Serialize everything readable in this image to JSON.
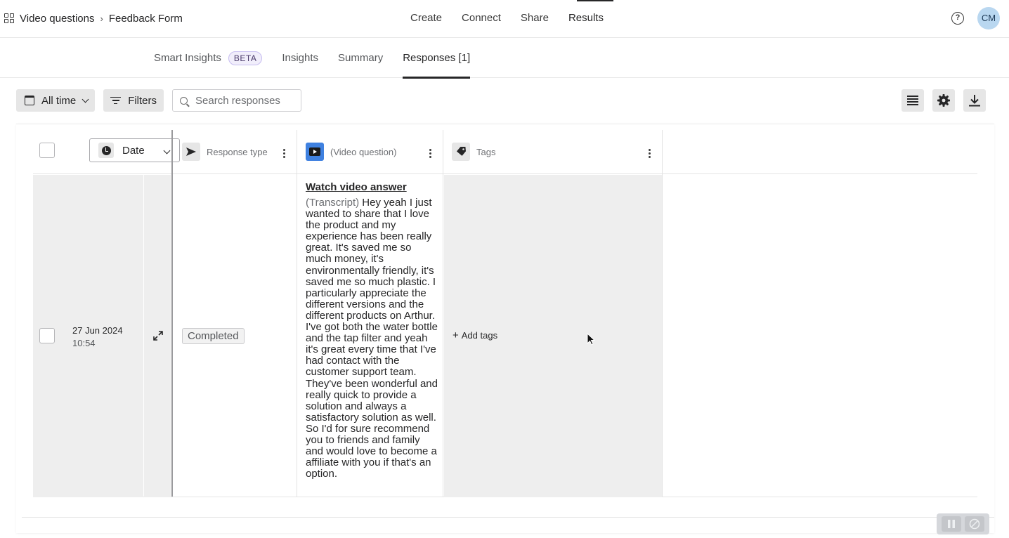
{
  "topbar": {
    "breadcrumb": [
      "Video questions",
      "Feedback Form"
    ],
    "nav": [
      "Create",
      "Connect",
      "Share",
      "Results"
    ],
    "active_nav": "Results",
    "help_glyph": "?",
    "avatar_initials": "CM",
    "avatar_color": "#b9d7f0"
  },
  "tabs": {
    "items": [
      {
        "label": "Smart Insights",
        "badge": "BETA"
      },
      {
        "label": "Insights"
      },
      {
        "label": "Summary"
      },
      {
        "label": "Responses [1]"
      }
    ],
    "active": "Responses [1]",
    "badge_color": "#c7bdf0"
  },
  "toolbar": {
    "date_range": "All time",
    "filters_label": "Filters",
    "search_placeholder": "Search responses",
    "icons": [
      "list-view-icon",
      "gear-icon",
      "download-icon"
    ]
  },
  "table": {
    "date_column_label": "Date",
    "columns": [
      {
        "label": "Response type",
        "icon": "send-arrow-icon"
      },
      {
        "label": "(Video question)",
        "icon": "video-play-icon"
      },
      {
        "label": "Tags",
        "icon": "tag-icon"
      }
    ],
    "video_icon_color": "#3f81e0",
    "rows": [
      {
        "date": "27 Jun 2024",
        "time": "10:54",
        "status": "Completed",
        "video_link": "Watch video answer",
        "transcript_label": "(Transcript)",
        "transcript": "Hey yeah I just wanted to share that I love the product and my experience has been really great. It's saved me so much money, it's environmentally friendly, it's saved me so much plastic. I particularly appreciate the different versions and the different products on Arthur. I've got both the water bottle and the tap filter and yeah it's great every time that I've had contact with the customer support team. They've been wonderful and really quick to provide a solution and always a satisfactory solution as well. So I'd for sure recommend you to friends and family and would love to become a affiliate with you if that's an option.",
        "add_tags": "Add tags"
      }
    ]
  }
}
